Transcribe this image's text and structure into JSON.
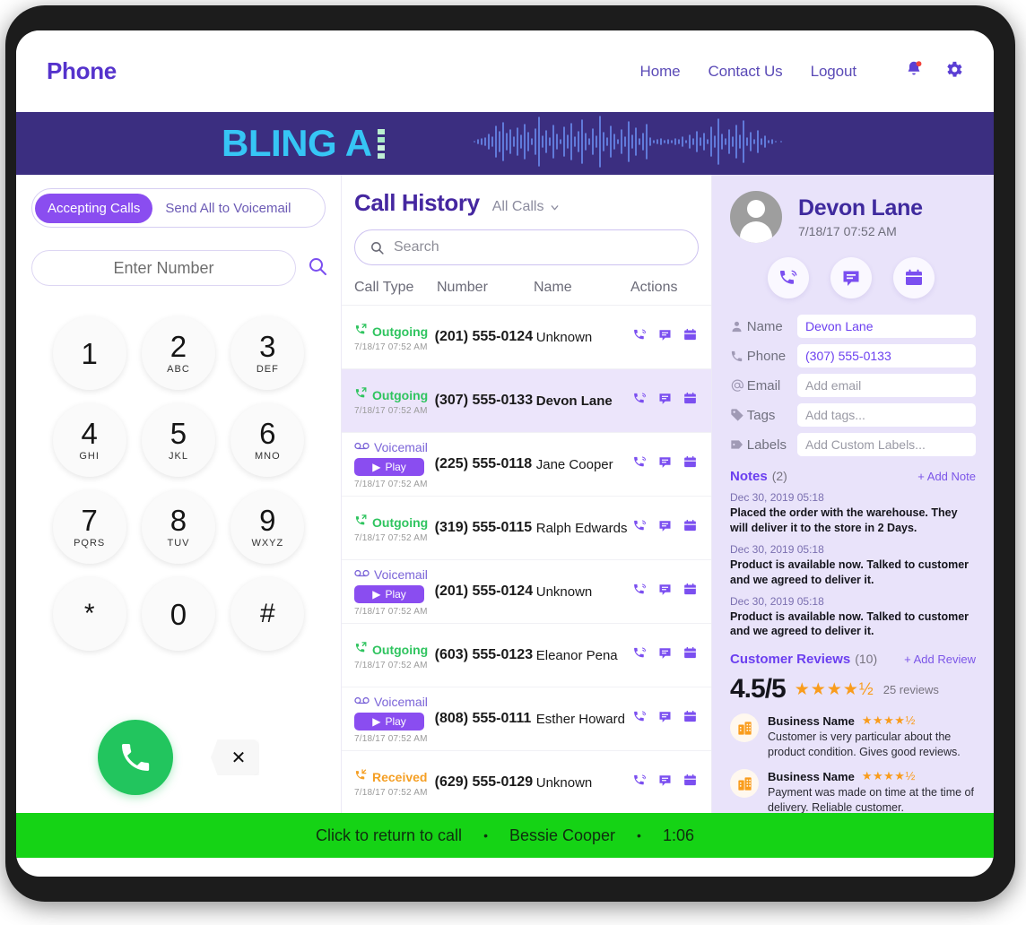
{
  "topbar": {
    "brand": "Phone",
    "links": [
      {
        "label": "Home"
      },
      {
        "label": "Contact Us"
      },
      {
        "label": "Logout"
      }
    ],
    "icons": [
      {
        "name": "notification-bell-icon"
      },
      {
        "name": "gear-icon"
      }
    ]
  },
  "banner": {
    "text": "BLING A",
    "bg_color": "#3b2e80",
    "text_color": "#36c5f5"
  },
  "dialer": {
    "status": {
      "accepting": "Accepting Calls",
      "voicemail": "Send All to Voicemail",
      "active": "Accepting Calls",
      "active_color": "#8a4df0"
    },
    "number_placeholder": "Enter Number",
    "number_value": "",
    "keys": [
      {
        "digit": "1",
        "letters": ""
      },
      {
        "digit": "2",
        "letters": "ABC"
      },
      {
        "digit": "3",
        "letters": "DEF"
      },
      {
        "digit": "4",
        "letters": "GHI"
      },
      {
        "digit": "5",
        "letters": "JKL"
      },
      {
        "digit": "6",
        "letters": "MNO"
      },
      {
        "digit": "7",
        "letters": "PQRS"
      },
      {
        "digit": "8",
        "letters": "TUV"
      },
      {
        "digit": "9",
        "letters": "WXYZ"
      },
      {
        "digit": "*",
        "letters": ""
      },
      {
        "digit": "0",
        "letters": ""
      },
      {
        "digit": "#",
        "letters": ""
      }
    ],
    "call_button": "call-icon",
    "clear_button": "✕"
  },
  "history": {
    "title": "Call History",
    "filter": "All Calls",
    "search_placeholder": "Search",
    "search_value": "",
    "columns": [
      "Call Type",
      "Number",
      "Name",
      "Actions"
    ],
    "rows": [
      {
        "type": "Outgoing",
        "type_class": "outgoing",
        "time": "7/18/17 07:52 AM",
        "number": "(201) 555-0124",
        "name": "Unknown",
        "selected": false,
        "play": ""
      },
      {
        "type": "Outgoing",
        "type_class": "outgoing",
        "time": "7/18/17 07:52 AM",
        "number": "(307) 555-0133",
        "name": "Devon Lane",
        "selected": true,
        "play": ""
      },
      {
        "type": "Voicemail",
        "type_class": "voicemail",
        "time": "7/18/17 07:52 AM",
        "number": "(225) 555-0118",
        "name": "Jane Cooper",
        "selected": false,
        "play": "Play"
      },
      {
        "type": "Outgoing",
        "type_class": "outgoing",
        "time": "7/18/17 07:52 AM",
        "number": "(319) 555-0115",
        "name": "Ralph Edwards",
        "selected": false,
        "play": ""
      },
      {
        "type": "Voicemail",
        "type_class": "voicemail",
        "time": "7/18/17 07:52 AM",
        "number": "(201) 555-0124",
        "name": "Unknown",
        "selected": false,
        "play": "Play"
      },
      {
        "type": "Outgoing",
        "type_class": "outgoing",
        "time": "7/18/17 07:52 AM",
        "number": "(603) 555-0123",
        "name": "Eleanor Pena",
        "selected": false,
        "play": ""
      },
      {
        "type": "Voicemail",
        "type_class": "voicemail",
        "time": "7/18/17 07:52 AM",
        "number": "(808) 555-0111",
        "name": "Esther Howard",
        "selected": false,
        "play": "Play"
      },
      {
        "type": "Received",
        "type_class": "received",
        "time": "7/18/17 07:52 AM",
        "number": "(629) 555-0129",
        "name": "Unknown",
        "selected": false,
        "play": ""
      }
    ],
    "row_actions": [
      "call-icon",
      "message-icon",
      "calendar-icon"
    ]
  },
  "contact": {
    "name": "Devon Lane",
    "timestamp": "7/18/17 07:52 AM",
    "actions": [
      "call-icon",
      "message-icon",
      "calendar-icon"
    ],
    "fields": [
      {
        "icon": "person-icon",
        "label": "Name",
        "value": "Devon Lane",
        "placeholder": ""
      },
      {
        "icon": "phone-icon",
        "label": "Phone",
        "value": "(307) 555-0133",
        "placeholder": ""
      },
      {
        "icon": "at-icon",
        "label": "Email",
        "value": "",
        "placeholder": "Add email"
      },
      {
        "icon": "tag-icon",
        "label": "Tags",
        "value": "",
        "placeholder": "Add tags..."
      },
      {
        "icon": "label-icon",
        "label": "Labels",
        "value": "",
        "placeholder": "Add Custom Labels..."
      }
    ],
    "notes": {
      "title": "Notes",
      "count": "(2)",
      "add_label": "+ Add Note",
      "items": [
        {
          "date": "Dec 30, 2019 05:18",
          "text": "Placed the order with the warehouse. They will deliver it to the store in 2 Days."
        },
        {
          "date": "Dec 30, 2019 05:18",
          "text": "Product is available now. Talked to customer and we agreed to deliver it."
        },
        {
          "date": "Dec 30, 2019 05:18",
          "text": "Product is available now. Talked to customer and we agreed to deliver it."
        }
      ]
    },
    "reviews": {
      "title": "Customer Reviews",
      "count": "(10)",
      "add_label": "+ Add Review",
      "score": "4.5/5",
      "stars": "★★★★½",
      "total": "25 reviews",
      "items": [
        {
          "name": "Business Name",
          "stars": "★★★★½",
          "text": "Customer is very particular about the product condition. Gives good reviews."
        },
        {
          "name": "Business Name",
          "stars": "★★★★½",
          "text": "Payment was made on time at the time of delivery. Reliable customer."
        }
      ]
    }
  },
  "callbar": {
    "label": "Click to return to call",
    "caller": "Bessie Cooper",
    "duration": "1:06",
    "separator": "•",
    "bg_color": "#15d315"
  }
}
